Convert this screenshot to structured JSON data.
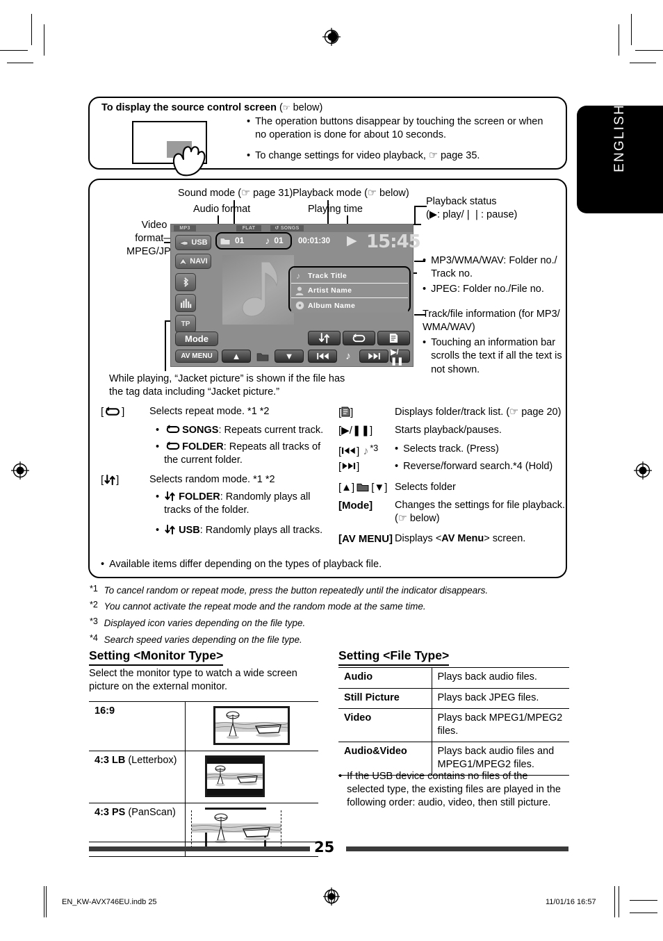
{
  "page": {
    "number": "25",
    "language_tab": "ENGLISH"
  },
  "top_box": {
    "title": "To display the source control screen",
    "title_suffix": "below)",
    "bullets": [
      "The operation buttons disappear by touching the screen or when no operation is done for about 10 seconds.",
      "To change settings for video playback, ☞ page 35."
    ]
  },
  "diagram": {
    "callouts": {
      "sound_mode": "Sound mode (☞ page 31)",
      "audio_format": "Audio format",
      "playback_mode": "Playback mode (☞ below)",
      "playing_time": "Playing time",
      "video_format_l1": "Video",
      "video_format_l2": "format—",
      "video_format_l3": "MPEG/JPEG",
      "playback_status_l1": "Playback status",
      "playback_status_l2": "(▶: play/❘❘: pause)",
      "folder_track_b1": "MP3/WMA/WAV: Folder no./ Track no.",
      "folder_track_b2": "JPEG: Folder no./File no.",
      "track_info_title": "Track/file information (for MP3/ WMA/WAV)",
      "track_info_bullet": "Touching an information bar scrolls the text if all the text is not shown.",
      "jacket_note": "While playing, “Jacket picture” is shown if the file has the tag data including “Jacket picture.”"
    },
    "screen": {
      "status_labels": [
        "MP3",
        "FLAT",
        "SONGS"
      ],
      "folder_no": "01",
      "track_no": "01",
      "playing_time": "00:01:30",
      "clock": "15:45",
      "play_indicator": "▶",
      "side_buttons": [
        "USB",
        "NAVI"
      ],
      "side_icons": [
        "bluetooth-icon",
        "equalizer-icon",
        "tp-icon"
      ],
      "tp_label": "TP",
      "mode_button": "Mode",
      "av_menu_button": "AV MENU",
      "info_bars": [
        {
          "icon": "note-icon",
          "label": "Track Title"
        },
        {
          "icon": "person-icon",
          "label": "Artist Name"
        },
        {
          "icon": "disc-icon",
          "label": "Album Name"
        }
      ],
      "transport_buttons": [
        "random-button",
        "repeat-button",
        "list-button",
        "prev-button",
        "note-button",
        "next-button",
        "play-pause-button"
      ],
      "folder_nav": [
        "folder-up-button",
        "folder-icon",
        "folder-down-button"
      ]
    }
  },
  "legend_left": [
    {
      "key": "[↻]",
      "key_icon": "repeat-icon",
      "desc": "Selects repeat mode. *1 *2",
      "bullets": [
        {
          "icon": "repeat-icon",
          "bold": "SONGS",
          "text": ": Repeats current track."
        },
        {
          "icon": "repeat-icon",
          "bold": "FOLDER",
          "text": ": Repeats all tracks of the current folder."
        }
      ]
    },
    {
      "key": "[↓↑]",
      "key_icon": "random-icon",
      "desc": "Selects random mode. *1 *2",
      "bullets": [
        {
          "icon": "random-icon",
          "bold": "FOLDER",
          "text": ": Randomly plays all tracks of the folder."
        },
        {
          "icon": "random-icon",
          "bold": "USB",
          "text": ": Randomly plays all tracks."
        }
      ]
    }
  ],
  "legend_right": [
    {
      "key_icon": "list-icon",
      "key": "[☰]",
      "desc": "Displays folder/track list. (☞ page 20)"
    },
    {
      "key_icon": "play-pause-icon",
      "key": "[▶/❘❘]",
      "desc": "Starts playback/pauses."
    },
    {
      "key_icon": "prev-icon",
      "key": "[❘◀◀]",
      "desc": "Selects track. (Press)",
      "note": "*3",
      "is_bullet": true
    },
    {
      "key_icon": "next-icon",
      "key": "[▶▶❘]",
      "desc": "Reverse/forward search.*4 (Hold)",
      "is_bullet": true
    },
    {
      "key_icon": "folder-icon",
      "key": "[▲]  [▼]",
      "desc": "Selects folder"
    },
    {
      "key_icon": "mode-icon",
      "key": "[Mode]",
      "desc": "Changes the settings for file playback. (☞ below)"
    },
    {
      "key_icon": "av-menu-icon",
      "key": "[AV MENU]",
      "desc": "Displays <AV Menu> screen."
    }
  ],
  "box_note": "Available items differ depending on the types of playback file.",
  "footnotes": [
    {
      "mark": "*1",
      "text": "To cancel random or repeat mode, press the button repeatedly until the indicator disappears."
    },
    {
      "mark": "*2",
      "text": "You cannot activate the repeat mode and the random mode at the same time."
    },
    {
      "mark": "*3",
      "text": "Displayed icon varies depending on the file type."
    },
    {
      "mark": "*4",
      "text": "Search speed varies depending on the file type."
    }
  ],
  "monitor_type": {
    "heading": "Setting <Monitor Type>",
    "intro": "Select the monitor type to watch a wide screen picture on the external monitor.",
    "rows": [
      {
        "label_bold": "16:9",
        "label_rest": "",
        "thumb": "wide"
      },
      {
        "label_bold": "4:3 LB",
        "label_rest": " (Letterbox)",
        "thumb": "letterbox"
      },
      {
        "label_bold": "4:3 PS",
        "label_rest": " (PanScan)",
        "thumb": "panscan"
      }
    ]
  },
  "file_type": {
    "heading": "Setting <File Type>",
    "rows": [
      {
        "name": "Audio",
        "desc": "Plays back audio files."
      },
      {
        "name": "Still Picture",
        "desc": "Plays back JPEG files."
      },
      {
        "name": "Video",
        "desc": "Plays back MPEG1/MPEG2 files."
      },
      {
        "name": "Audio&Video",
        "desc": "Plays back audio files and MPEG1/MPEG2 files."
      }
    ],
    "note": "If the USB device contains no files of the selected type, the existing files are played in the following order: audio, video, then still picture."
  },
  "footer": {
    "file": "EN_KW-AVX746EU.indb   25",
    "timestamp": "11/01/16   16:57"
  }
}
